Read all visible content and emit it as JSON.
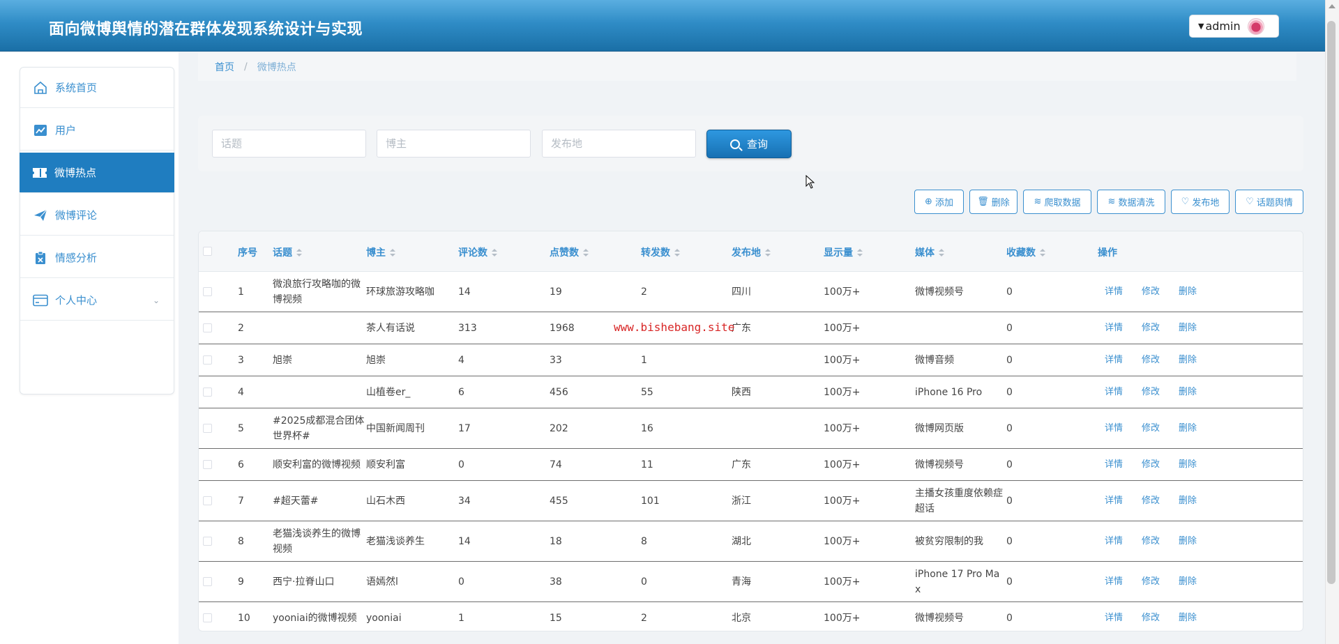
{
  "header": {
    "title": "面向微博舆情的潜在群体发现系统设计与实现",
    "user": "admin"
  },
  "sidebar": {
    "items": [
      {
        "label": "系统首页",
        "icon": "home-icon"
      },
      {
        "label": "用户",
        "icon": "chart-icon"
      },
      {
        "label": "微博热点",
        "icon": "ticket-icon"
      },
      {
        "label": "微博评论",
        "icon": "send-icon"
      },
      {
        "label": "情感分析",
        "icon": "clipboard-icon"
      },
      {
        "label": "个人中心",
        "icon": "card-icon"
      }
    ]
  },
  "breadcrumb": {
    "home": "首页",
    "sep": "/",
    "current": "微博热点"
  },
  "search": {
    "topic_placeholder": "话题",
    "blogger_placeholder": "博主",
    "location_placeholder": "发布地",
    "query_label": "查询"
  },
  "toolbar": [
    {
      "label": "添加",
      "icon": "plus-circle-icon"
    },
    {
      "label": "删除",
      "icon": "trash-icon"
    },
    {
      "label": "爬取数据",
      "icon": "database-icon"
    },
    {
      "label": "数据清洗",
      "icon": "database-icon"
    },
    {
      "label": "发布地",
      "icon": "heart-icon"
    },
    {
      "label": "话题舆情",
      "icon": "heart-icon"
    }
  ],
  "table": {
    "columns": [
      "序号",
      "话题",
      "博主",
      "评论数",
      "点赞数",
      "转发数",
      "发布地",
      "显示量",
      "媒体",
      "收藏数",
      "操作"
    ],
    "actions": {
      "detail": "详情",
      "edit": "修改",
      "delete": "删除"
    },
    "rows": [
      {
        "no": "1",
        "topic": [
          "微浪旅行攻略咖的微",
          "博视频"
        ],
        "blogger": "环球旅游攻略咖",
        "comments": "14",
        "likes": "19",
        "reposts": "2",
        "location": "四川",
        "views": "100万+",
        "media": [
          "微博视频号"
        ],
        "favorites": "0"
      },
      {
        "no": "2",
        "topic": [
          ""
        ],
        "blogger": "茶人有话说",
        "comments": "313",
        "likes": "1968",
        "reposts": "",
        "location": "广东",
        "views": "100万+",
        "media": [
          ""
        ],
        "favorites": "0"
      },
      {
        "no": "3",
        "topic": [
          "旭崇"
        ],
        "blogger": "旭崇",
        "comments": "4",
        "likes": "33",
        "reposts": "1",
        "location": "",
        "views": "100万+",
        "media": [
          "微博音频"
        ],
        "favorites": "0"
      },
      {
        "no": "4",
        "topic": [
          ""
        ],
        "blogger": "山植卷er_",
        "comments": "6",
        "likes": "456",
        "reposts": "55",
        "location": "陕西",
        "views": "100万+",
        "media": [
          "iPhone 16 Pro"
        ],
        "favorites": "0"
      },
      {
        "no": "5",
        "topic": [
          "#2025成都混合团体",
          "世界杯#"
        ],
        "blogger": "中国新闻周刊",
        "comments": "17",
        "likes": "202",
        "reposts": "16",
        "location": "",
        "views": "100万+",
        "media": [
          "微博网页版"
        ],
        "favorites": "0"
      },
      {
        "no": "6",
        "topic": [
          "顺安利富的微博视频"
        ],
        "blogger": "顺安利富",
        "comments": "0",
        "likes": "74",
        "reposts": "11",
        "location": "广东",
        "views": "100万+",
        "media": [
          "微博视频号"
        ],
        "favorites": "0"
      },
      {
        "no": "7",
        "topic": [
          "#超天蕾#"
        ],
        "blogger": "山石木西",
        "comments": "34",
        "likes": "455",
        "reposts": "101",
        "location": "浙江",
        "views": "100万+",
        "media": [
          "主播女孩重度依赖症",
          "超话"
        ],
        "favorites": "0"
      },
      {
        "no": "8",
        "topic": [
          "老猫浅谈养生的微博",
          "视频"
        ],
        "blogger": "老猫浅谈养生",
        "comments": "14",
        "likes": "18",
        "reposts": "8",
        "location": "湖北",
        "views": "100万+",
        "media": [
          "被贫穷限制的我"
        ],
        "favorites": "0"
      },
      {
        "no": "9",
        "topic": [
          "西宁·拉脊山口"
        ],
        "blogger": "语嫣然l",
        "comments": "0",
        "likes": "38",
        "reposts": "0",
        "location": "青海",
        "views": "100万+",
        "media": [
          "iPhone 17 Pro Ma",
          "x"
        ],
        "favorites": "0"
      },
      {
        "no": "10",
        "topic": [
          "yooniai的微博视频"
        ],
        "blogger": "yooniai",
        "comments": "1",
        "likes": "15",
        "reposts": "2",
        "location": "北京",
        "views": "100万+",
        "media": [
          "微博视频号"
        ],
        "favorites": "0"
      }
    ]
  },
  "watermark": "www.bishebang.site"
}
